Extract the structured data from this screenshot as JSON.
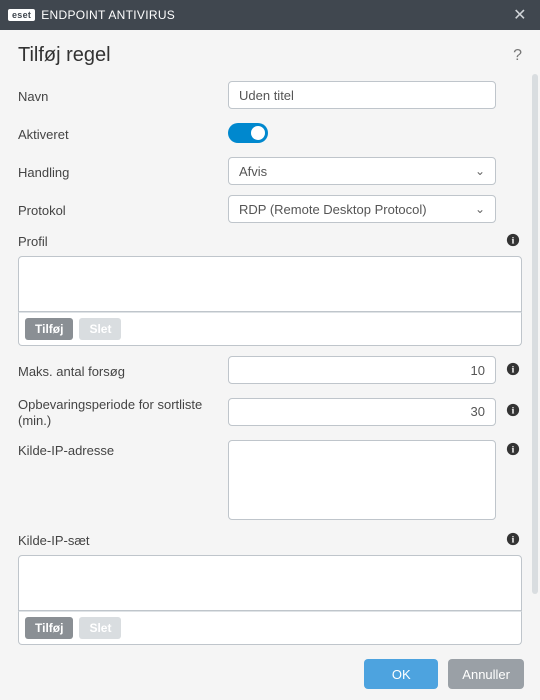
{
  "titlebar": {
    "logo": "eset",
    "product": "ENDPOINT ANTIVIRUS"
  },
  "header": {
    "title": "Tilføj regel"
  },
  "labels": {
    "name": "Navn",
    "enabled": "Aktiveret",
    "action": "Handling",
    "protocol": "Protokol",
    "profile": "Profil",
    "max_attempts": "Maks. antal forsøg",
    "blocklist_retention": "Opbevaringsperiode for sortliste (min.)",
    "source_ip": "Kilde-IP-adresse",
    "source_ip_set": "Kilde-IP-sæt"
  },
  "values": {
    "name": "Uden titel",
    "enabled": true,
    "action": "Afvis",
    "protocol": "RDP (Remote Desktop Protocol)",
    "max_attempts": "10",
    "blocklist_retention": "30"
  },
  "buttons": {
    "add": "Tilføj",
    "delete": "Slet",
    "ok": "OK",
    "cancel": "Annuller"
  }
}
